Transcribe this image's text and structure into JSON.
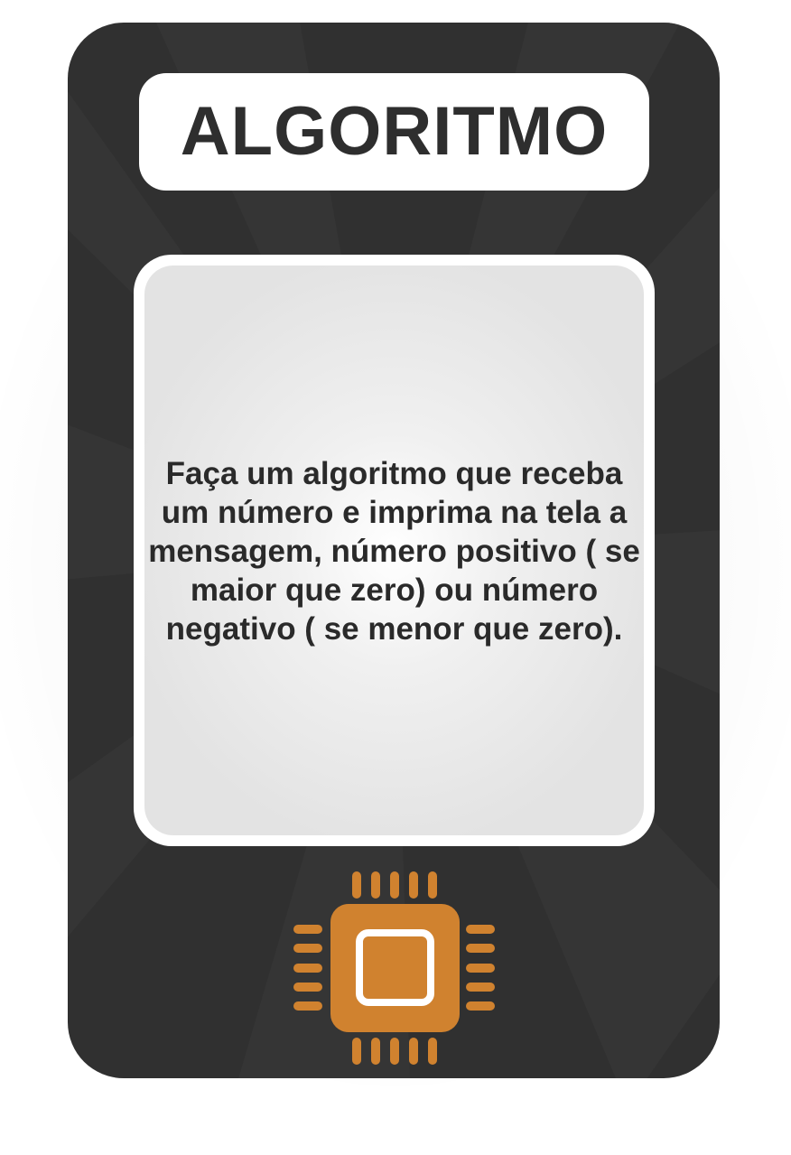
{
  "card": {
    "title": "ALGORITMO",
    "body": "Faça um algoritmo que receba um número e imprima na tela a mensagem, número positivo ( se maior que zero) ou número negativo ( se menor que zero).",
    "icon": "microchip-icon"
  },
  "colors": {
    "card_background": "#303030",
    "title_background": "#ffffff",
    "title_text": "#2e2e2e",
    "panel_background": "#e3e3e3",
    "body_text": "#2a2a2a",
    "chip": "#d0822f"
  }
}
